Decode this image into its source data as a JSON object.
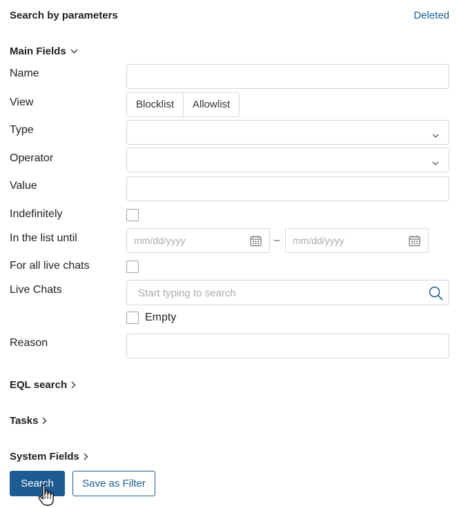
{
  "header": {
    "title": "Search by parameters",
    "deleted_label": "Deleted"
  },
  "sections": {
    "main_fields": "Main Fields",
    "eql_search": "EQL search",
    "tasks": "Tasks",
    "system_fields": "System Fields"
  },
  "fields": {
    "name": {
      "label": "Name",
      "value": ""
    },
    "view": {
      "label": "View",
      "options": [
        "Blocklist",
        "Allowlist"
      ]
    },
    "type": {
      "label": "Type",
      "value": ""
    },
    "operator": {
      "label": "Operator",
      "value": ""
    },
    "value": {
      "label": "Value",
      "value": ""
    },
    "indefinitely": {
      "label": "Indefinitely",
      "checked": false
    },
    "in_list_until": {
      "label": "In the list until",
      "from_placeholder": "mm/dd/yyyy",
      "to_placeholder": "mm/dd/yyyy",
      "separator": "–"
    },
    "all_live_chats": {
      "label": "For all live chats",
      "checked": false
    },
    "live_chats": {
      "label": "Live Chats",
      "placeholder": "Start typing to search",
      "empty_label": "Empty",
      "empty_checked": false
    },
    "reason": {
      "label": "Reason",
      "value": ""
    }
  },
  "buttons": {
    "search": "Search",
    "save_filter": "Save as Filter"
  },
  "icons": {
    "section_expanded": "chevron-down-icon",
    "section_collapsed": "chevron-right-icon",
    "select": "chevron-down-icon",
    "date": "calendar-icon",
    "search": "search-icon",
    "cursor": "hand-pointer-cursor"
  },
  "colors": {
    "accent": "#1d5c91",
    "link": "#1a5c92",
    "border": "#d4d7dc"
  }
}
